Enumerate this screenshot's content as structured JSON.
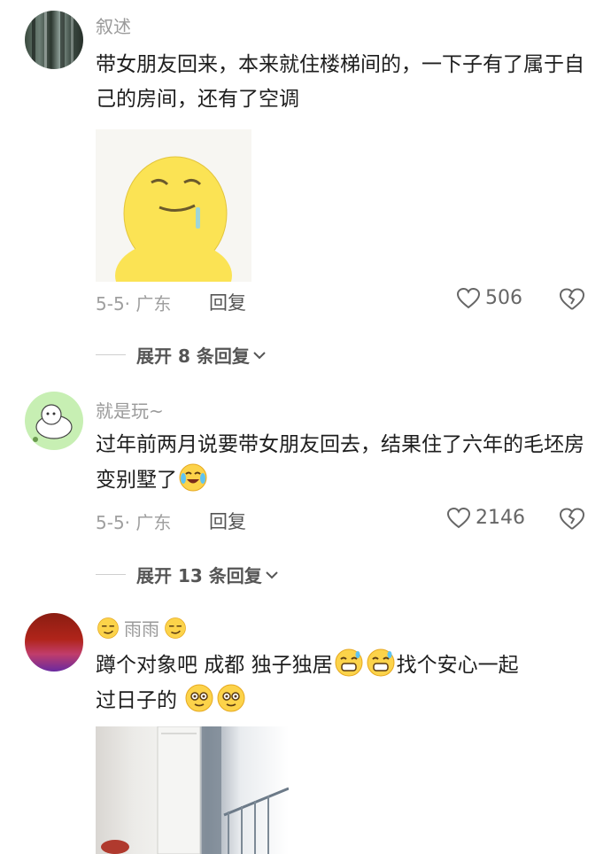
{
  "comments": [
    {
      "username": "叙述",
      "text": "带女朋友回来，本来就住楼梯间的，一下子有了属于自己的房间，还有了空调",
      "meta": "5-5· 广东",
      "reply_label": "回复",
      "likes": "506",
      "expand_label": "展开 8 条回复"
    },
    {
      "username": "就是玩~",
      "text": "过年前两月说要带女朋友回去，结果住了六年的毛坯房变别墅了",
      "meta": "5-5· 广东",
      "reply_label": "回复",
      "likes": "2146",
      "expand_label": "展开 13 条回复"
    },
    {
      "username": "雨雨",
      "text_part1": "蹲个对象吧 成都 独子独居",
      "text_part2": "找个安心一起",
      "text_part3": "过日子的"
    }
  ],
  "icons": {
    "like": "heart-outline-icon",
    "dislike": "broken-heart-icon",
    "expand": "chevron-down-icon"
  }
}
